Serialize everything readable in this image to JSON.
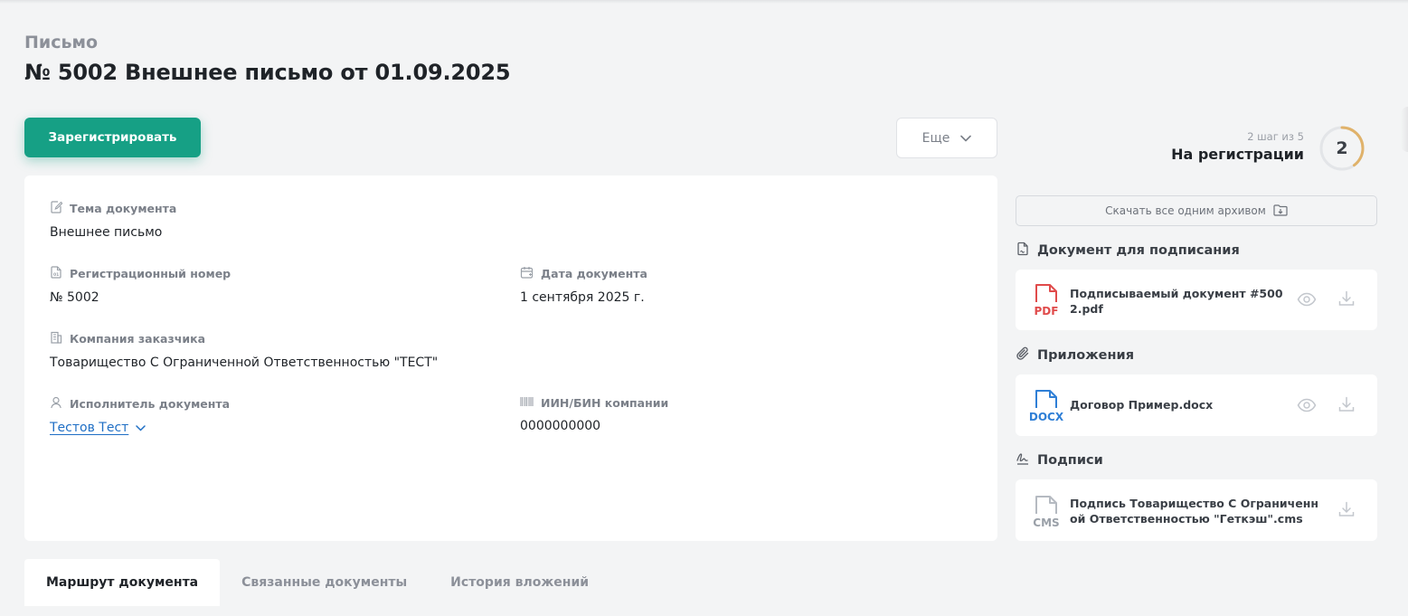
{
  "header": {
    "doc_type": "Письмо",
    "title": "№ 5002 Внешнее письмо от 01.09.2025"
  },
  "toolbar": {
    "register_label": "Зарегистрировать",
    "more_label": "Еще"
  },
  "details": {
    "subject": {
      "label": "Тема документа",
      "value": "Внешнее письмо"
    },
    "reg_number": {
      "label": "Регистрационный номер",
      "value": "№ 5002"
    },
    "doc_date": {
      "label": "Дата документа",
      "value": "1 сентября 2025 г."
    },
    "company": {
      "label": "Компания заказчика",
      "value": "Товарищество С Ограниченной Ответственностью \"ТЕСТ\""
    },
    "executor": {
      "label": "Исполнитель документа",
      "value": "Тестов Тест"
    },
    "iin_bin": {
      "label": "ИИН/БИН компании",
      "value": "0000000000"
    }
  },
  "status": {
    "step_text": "2 шаг из 5",
    "name": "На регистрации",
    "step_number": "2",
    "progress_fraction": 0.4,
    "ring_color": "#e0b26a"
  },
  "files": {
    "archive_label": "Скачать все одним архивом",
    "sign_section": {
      "title": "Документ для подписания",
      "items": [
        {
          "name": "Подписываемый документ #5002.pdf",
          "ext": "PDF",
          "color": "#e04b4b"
        }
      ]
    },
    "attachments_section": {
      "title": "Приложения",
      "items": [
        {
          "name": "Договор Пример.docx",
          "ext": "DOCX",
          "color": "#2f7fd6"
        }
      ]
    },
    "signatures_section": {
      "title": "Подписи",
      "items": [
        {
          "name": "Подпись Товарищество С Ограниченной Ответственностью \"Геткэш\".cms",
          "ext": "CMS",
          "color": "#9aa0a8"
        }
      ]
    }
  },
  "tabs": [
    {
      "label": "Маршрут документа",
      "active": true
    },
    {
      "label": "Связанные документы",
      "active": false
    },
    {
      "label": "История вложений",
      "active": false
    }
  ],
  "colors": {
    "primary": "#16a085",
    "link": "#1f6fc5",
    "background": "#f3f4f5"
  }
}
